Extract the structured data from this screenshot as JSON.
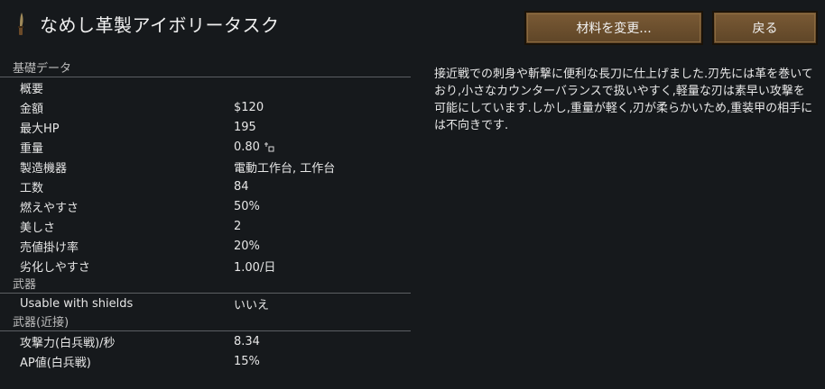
{
  "header": {
    "title": "なめし革製アイボリータスク",
    "icon": "tusk-weapon-icon",
    "buttons": {
      "change_material": "材料を変更...",
      "back": "戻る"
    }
  },
  "stats": {
    "basic": {
      "header": "基礎データ",
      "overview": "概要",
      "rows": [
        {
          "label": "金額",
          "value": "$120"
        },
        {
          "label": "最大HP",
          "value": "195"
        },
        {
          "label": "重量",
          "value": "0.80"
        },
        {
          "label": "製造機器",
          "value": "電動工作台, 工作台"
        },
        {
          "label": "工数",
          "value": "84"
        },
        {
          "label": "燃えやすさ",
          "value": "50%"
        },
        {
          "label": "美しさ",
          "value": "2"
        },
        {
          "label": "売値掛け率",
          "value": "20%"
        },
        {
          "label": "劣化しやすさ",
          "value": "1.00/日"
        }
      ]
    },
    "weapon": {
      "header": "武器",
      "rows": [
        {
          "label": "Usable with shields",
          "value": "いいえ"
        }
      ]
    },
    "melee": {
      "header": "武器(近接)",
      "rows": [
        {
          "label": "攻撃力(白兵戦)/秒",
          "value": "8.34"
        },
        {
          "label": "AP値(白兵戦)",
          "value": "15%"
        }
      ]
    }
  },
  "description": "接近戦での刺身や斬撃に便利な長刀に仕上げました.刃先には革を巻いており,小さなカウンターバランスで扱いやすく,軽量な刃は素早い攻撃を可能にしています.しかし,重量が軽く,刃が柔らかいため,重装甲の相手には不向きです."
}
